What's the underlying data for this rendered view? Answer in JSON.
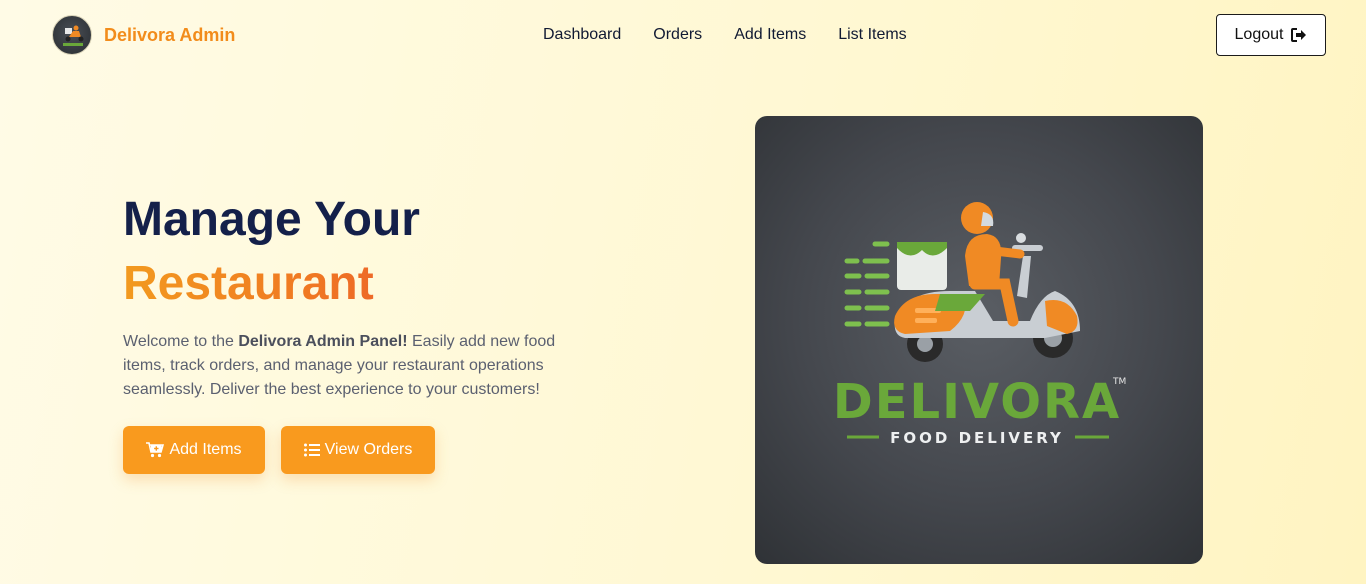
{
  "navbar": {
    "brand_name": "Delivora Admin",
    "links": [
      "Dashboard",
      "Orders",
      "Add Items",
      "List Items"
    ],
    "logout_label": "Logout"
  },
  "hero": {
    "title_line1": "Manage Your",
    "title_line2": "Restaurant",
    "desc_prefix": "Welcome to the ",
    "desc_bold": "Delivora Admin Panel!",
    "desc_rest": " Easily add new food items, track orders, and manage your restaurant operations seamlessly. Deliver the best experience to your customers!",
    "buttons": {
      "add_items": "Add Items",
      "view_orders": "View Orders"
    }
  },
  "logo_image": {
    "wordmark": "DELIVORA",
    "trademark": "TM",
    "tagline": "FOOD DELIVERY"
  },
  "colors": {
    "brand_orange": "#f28c1b",
    "button_orange": "#f99a1e",
    "title_navy": "#14204a",
    "logo_green": "#6aa83a"
  },
  "icons": {
    "logout": "sign-out-icon",
    "add_items": "cart-plus-icon",
    "view_orders": "list-icon"
  }
}
